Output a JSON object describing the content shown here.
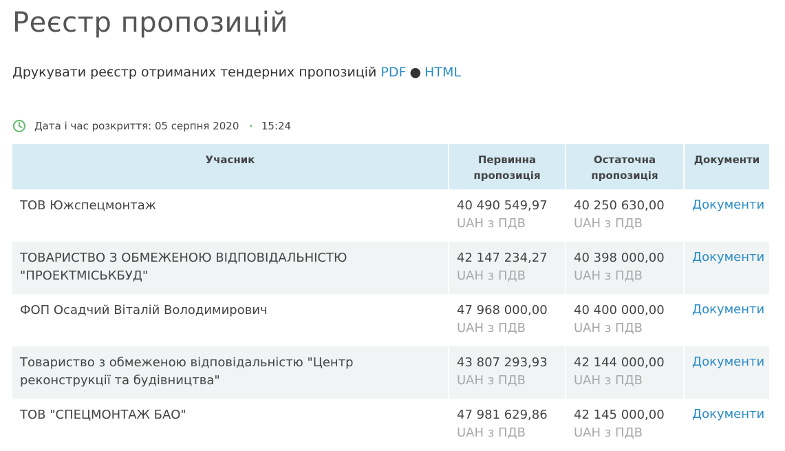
{
  "page": {
    "title": "Реєстр пропозицій"
  },
  "print": {
    "text": "Друкувати реєстр отриманих тендерних пропозицій",
    "pdf_label": "PDF",
    "separator": "●",
    "html_label": "HTML"
  },
  "opening": {
    "label": "Дата і час розкриття: 05 серпня 2020",
    "separator": "•",
    "time": "15:24",
    "icon": "clock-icon",
    "icon_color": "#6cc07a"
  },
  "table": {
    "headers": {
      "participant": "Учасник",
      "initial": "Первинна пропозиція",
      "final": "Остаточна пропозиція",
      "documents": "Документи"
    },
    "header_bg": "#d6ebf4",
    "rows": [
      {
        "participant": "ТОВ Южспецмонтаж",
        "initial_amount": "40 490 549,97",
        "initial_vat": "UAH з ПДВ",
        "final_amount": "40 250 630,00",
        "final_vat": "UAH з ПДВ",
        "documents_label": "Документи"
      },
      {
        "participant": "ТОВАРИСТВО З ОБМЕЖЕНОЮ ВІДПОВІДАЛЬНІСТЮ \"ПРОЕКТМІСЬКБУД\"",
        "initial_amount": "42 147 234,27",
        "initial_vat": "UAH з ПДВ",
        "final_amount": "40 398 000,00",
        "final_vat": "UAH з ПДВ",
        "documents_label": "Документи"
      },
      {
        "participant": "ФОП Осадчий Віталій Володимирович",
        "initial_amount": "47 968 000,00",
        "initial_vat": "UAH з ПДВ",
        "final_amount": "40 400 000,00",
        "final_vat": "UAH з ПДВ",
        "documents_label": "Документи"
      },
      {
        "participant": "Товариство з обмеженою відповідальністю \"Центр реконструкції та будівництва\"",
        "initial_amount": "43 807 293,93",
        "initial_vat": "UAH з ПДВ",
        "final_amount": "42 144 000,00",
        "final_vat": "UAH з ПДВ",
        "documents_label": "Документи"
      },
      {
        "participant": "ТОВ \"СПЕЦМОНТАЖ БАО\"",
        "initial_amount": "47 981 629,86",
        "initial_vat": "UAH з ПДВ",
        "final_amount": "42 145 000,00",
        "final_vat": "UAH з ПДВ",
        "documents_label": "Документи"
      }
    ]
  },
  "colors": {
    "link": "#2a8cc6",
    "row_alt_bg": "#f1f4f4",
    "muted_text": "#a8a8a8"
  }
}
